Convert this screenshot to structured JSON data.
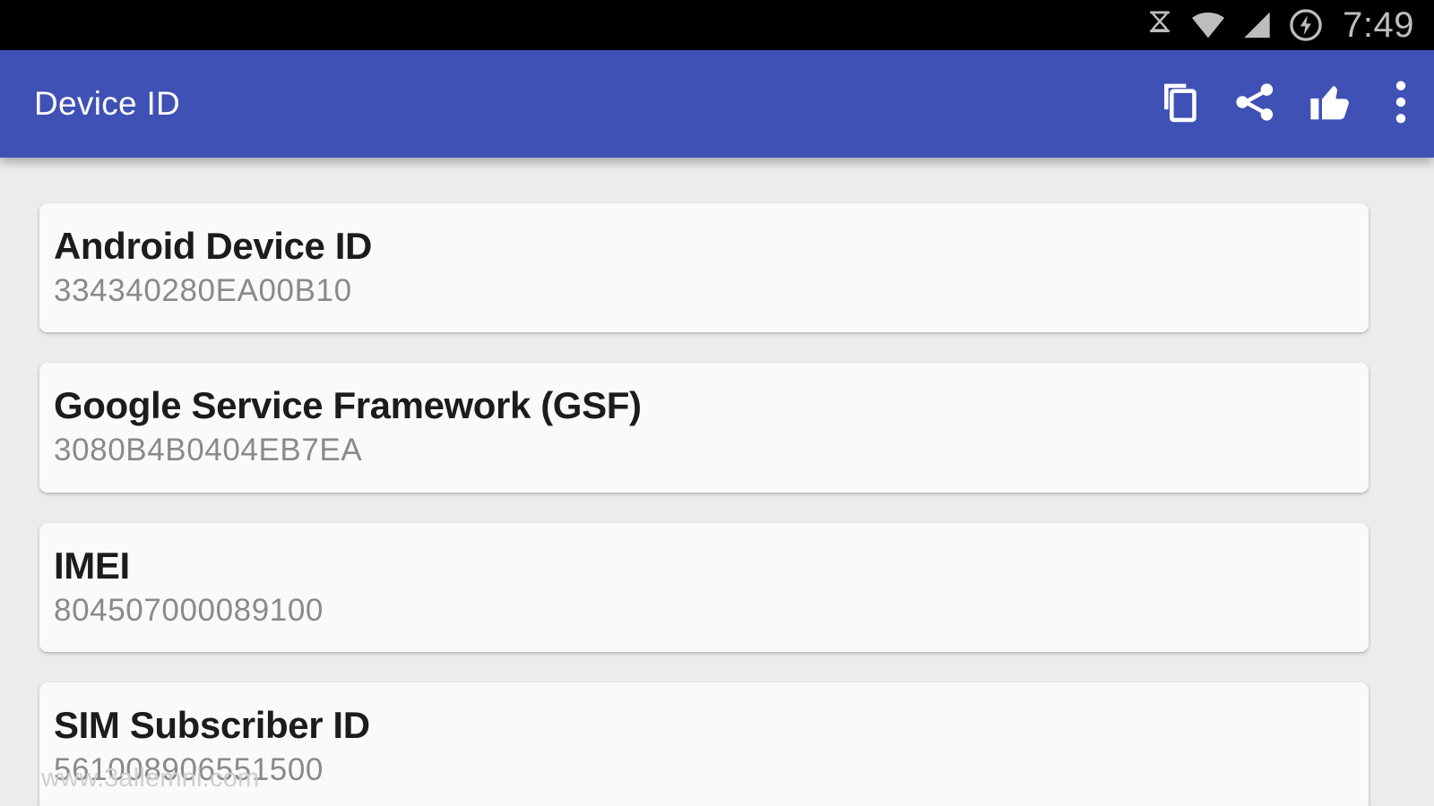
{
  "status_bar": {
    "clock": "7:49",
    "icons": [
      {
        "name": "screen-rotation-lock-icon",
        "glyph": "hourglass"
      },
      {
        "name": "wifi-icon",
        "glyph": "wifi"
      },
      {
        "name": "cellular-signal-icon",
        "glyph": "signal"
      },
      {
        "name": "battery-charging-icon",
        "glyph": "bolt-circle"
      }
    ],
    "background": "#000000",
    "icon_color": "#BDBDBD"
  },
  "app_bar": {
    "title": "Device ID",
    "background": "#3F51B5",
    "title_color": "#FFFFFF",
    "actions": [
      {
        "name": "copy-button",
        "label": "Copy",
        "icon": "copy-icon"
      },
      {
        "name": "share-button",
        "label": "Share",
        "icon": "share-icon"
      },
      {
        "name": "rate-button",
        "label": "Rate",
        "icon": "thumb-up-icon"
      },
      {
        "name": "overflow-menu-button",
        "label": "More options",
        "icon": "more-vertical-icon"
      }
    ]
  },
  "content": {
    "background": "#ECECEC",
    "card_background": "#FAFAFA",
    "title_color": "#1C1C1C",
    "value_color": "#8A8A8A",
    "cards": [
      {
        "title": "Android Device ID",
        "value": "334340280EA00B10"
      },
      {
        "title": "Google Service Framework (GSF)",
        "value": "3080B4B0404EB7EA"
      },
      {
        "title": "IMEI",
        "value": "804507000089100"
      },
      {
        "title": "SIM Subscriber ID",
        "value": "561008906551500"
      }
    ]
  },
  "watermark": {
    "text": "www.3allemni.com",
    "color": "#CFCFCF"
  }
}
